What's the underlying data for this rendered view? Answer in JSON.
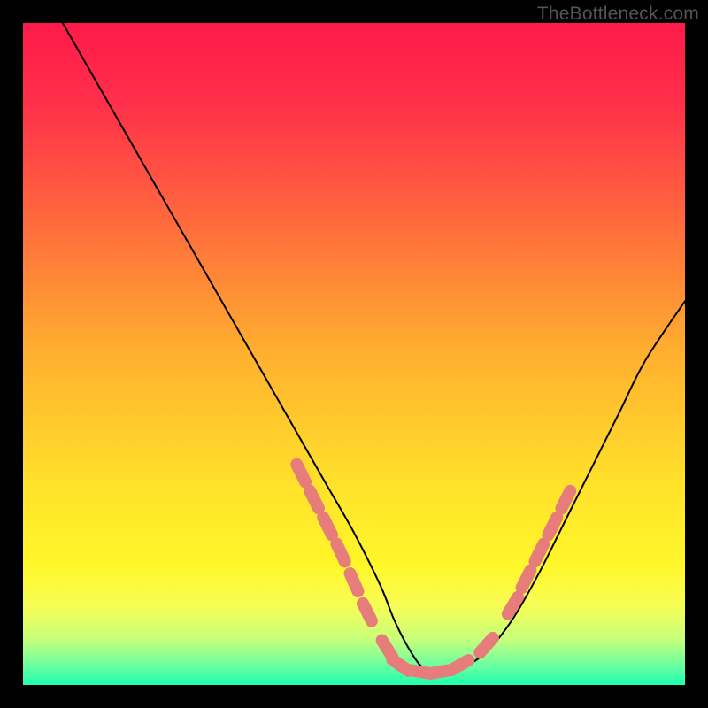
{
  "watermark": "TheBottleneck.com",
  "chart_data": {
    "type": "line",
    "title": "",
    "xlabel": "",
    "ylabel": "",
    "xlim": [
      0,
      100
    ],
    "ylim": [
      0,
      100
    ],
    "grid": false,
    "legend": false,
    "background_gradient_stops": [
      {
        "offset": 0.0,
        "color": "#ff1a4a"
      },
      {
        "offset": 0.12,
        "color": "#ff2f4a"
      },
      {
        "offset": 0.3,
        "color": "#ff6a3d"
      },
      {
        "offset": 0.5,
        "color": "#ffb02f"
      },
      {
        "offset": 0.7,
        "color": "#ffe22a"
      },
      {
        "offset": 0.82,
        "color": "#fff72a"
      },
      {
        "offset": 0.88,
        "color": "#f7fd55"
      },
      {
        "offset": 0.93,
        "color": "#c8ff7a"
      },
      {
        "offset": 0.97,
        "color": "#6dffa0"
      },
      {
        "offset": 1.0,
        "color": "#1fffb0"
      }
    ],
    "series": [
      {
        "name": "bottleneck-curve",
        "color": "#000000",
        "x": [
          6,
          10,
          14,
          18,
          22,
          26,
          30,
          34,
          38,
          42,
          46,
          50,
          54,
          56,
          58,
          60,
          62,
          66,
          70,
          74,
          78,
          82,
          86,
          90,
          94,
          100
        ],
        "y": [
          100,
          93,
          86,
          79,
          72,
          65,
          58,
          51,
          44,
          37,
          30,
          23,
          15,
          10,
          6,
          3,
          2,
          2.5,
          5,
          10,
          17,
          25,
          33,
          41,
          49,
          58
        ]
      }
    ],
    "markers": {
      "name": "highlight-beads",
      "color": "#e77d7a",
      "points": [
        {
          "x": 42,
          "y": 32
        },
        {
          "x": 44,
          "y": 28
        },
        {
          "x": 46,
          "y": 24
        },
        {
          "x": 48,
          "y": 20
        },
        {
          "x": 50,
          "y": 15.5
        },
        {
          "x": 52,
          "y": 11
        },
        {
          "x": 55,
          "y": 5.5
        },
        {
          "x": 57,
          "y": 3
        },
        {
          "x": 60,
          "y": 2
        },
        {
          "x": 63,
          "y": 2
        },
        {
          "x": 66,
          "y": 3
        },
        {
          "x": 70,
          "y": 6
        },
        {
          "x": 74,
          "y": 12
        },
        {
          "x": 76,
          "y": 16
        },
        {
          "x": 78,
          "y": 20
        },
        {
          "x": 80,
          "y": 24
        },
        {
          "x": 82,
          "y": 28
        }
      ]
    }
  }
}
